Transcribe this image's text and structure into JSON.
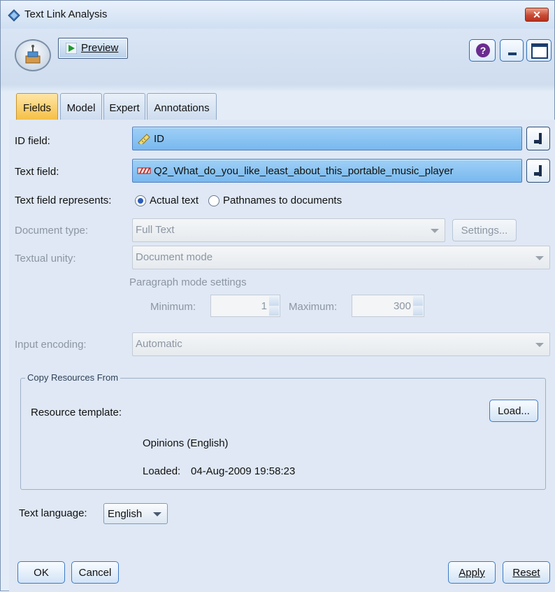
{
  "window": {
    "title": "Text Link Analysis",
    "close_glyph": "✕"
  },
  "toolbar": {
    "preview_label": "Preview",
    "help_glyph": "?"
  },
  "tabs": [
    {
      "label": "Fields",
      "active": true
    },
    {
      "label": "Model",
      "active": false
    },
    {
      "label": "Expert",
      "active": false
    },
    {
      "label": "Annotations",
      "active": false
    }
  ],
  "fields": {
    "id_field_label": "ID field:",
    "id_field_value": "ID",
    "text_field_label": "Text field:",
    "text_field_value": "Q2_What_do_you_like_least_about_this_portable_music_player",
    "represents_label": "Text field represents:",
    "represents_options": [
      "Actual text",
      "Pathnames to documents"
    ],
    "represents_selected": "Actual text",
    "document_type_label": "Document type:",
    "document_type_value": "Full Text",
    "settings_label": "Settings...",
    "textual_unity_label": "Textual unity:",
    "textual_unity_value": "Document mode",
    "paragraph_settings_label": "Paragraph mode settings",
    "minimum_label": "Minimum:",
    "minimum_value": "1",
    "maximum_label": "Maximum:",
    "maximum_value": "300",
    "input_encoding_label": "Input encoding:",
    "input_encoding_value": "Automatic"
  },
  "resources": {
    "group_title": "Copy Resources From",
    "template_label": "Resource template:",
    "load_label": "Load...",
    "template_name": "Opinions (English)",
    "loaded_label": "Loaded:",
    "loaded_value": "04-Aug-2009 19:58:23"
  },
  "language": {
    "label": "Text language:",
    "value": "English"
  },
  "footer": {
    "ok": "OK",
    "cancel": "Cancel",
    "apply": "Apply",
    "reset": "Reset"
  },
  "colors": {
    "active_tab": "#f5bf46",
    "field_combo": "#78b8ef",
    "close": "#c94a35",
    "radio_on": "#2b5db8"
  }
}
